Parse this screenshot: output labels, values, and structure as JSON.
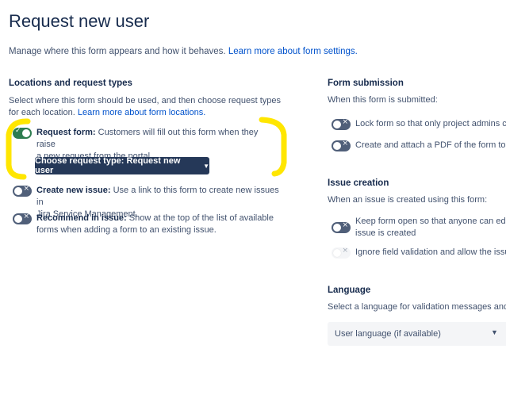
{
  "page": {
    "title": "Request new user",
    "intro_text": "Manage where this form appears and how it behaves.",
    "intro_link": "Learn more about form settings."
  },
  "locations": {
    "heading": "Locations and request types",
    "description_line1": "Select where this form should be used, and then choose request types",
    "description_line2": "for each location.",
    "description_link": "Learn more about form locations.",
    "request_form": {
      "label": "Request form:",
      "text_line1": "Customers will fill out this form when they raise",
      "text_line2": "a new request from the portal.",
      "enabled": true
    },
    "request_type_button": "Choose request type: Request new user",
    "create_issue": {
      "label": "Create new issue:",
      "text_line1": "Use a link to this form to create new issues in",
      "text_line2": "Jira Service Management.",
      "enabled": false
    },
    "recommend": {
      "label": "Recommend in issue:",
      "text_line1": "Show at the top of the list of available",
      "text_line2": "forms when adding a form to an existing issue.",
      "enabled": false
    }
  },
  "submission": {
    "heading": "Form submission",
    "description": "When this form is submitted:",
    "lock_text": "Lock form so that only project admins car",
    "pdf_text": "Create and attach a PDF of the form to th"
  },
  "issue_creation": {
    "heading": "Issue creation",
    "description": "When an issue is created using this form:",
    "keep_open_line1": "Keep form open so that anyone can edit a",
    "keep_open_line2": "issue is created",
    "ignore_validation": "Ignore field validation and allow the issue"
  },
  "language": {
    "heading": "Language",
    "description": "Select a language for validation messages and bu",
    "selected": "User language (if available)"
  },
  "icons": {
    "toggle_off": "×",
    "toggle_on": "✓",
    "chevron": "chevron-down-icon"
  },
  "colors": {
    "toggle_on": "#2E7D50",
    "toggle_off": "#505F79",
    "button": "#253858",
    "link": "#0052CC",
    "highlight": "#FFE600"
  }
}
